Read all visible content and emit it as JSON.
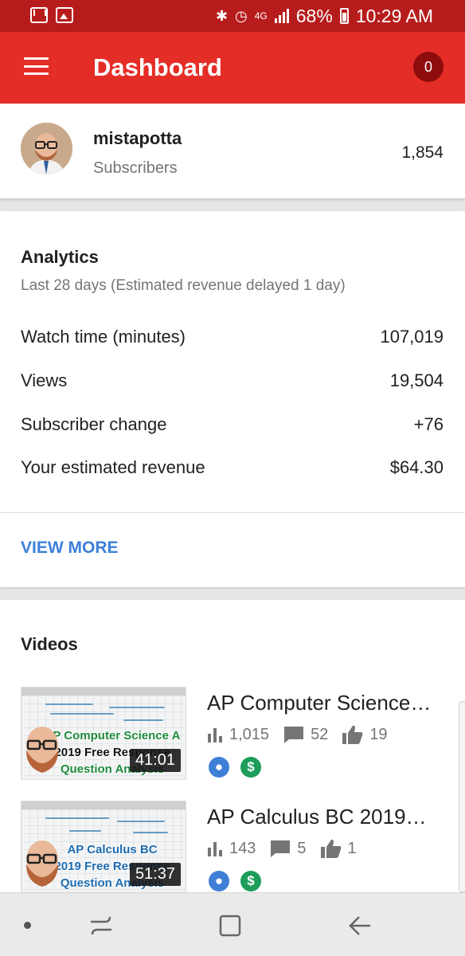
{
  "status_bar": {
    "battery": "68%",
    "time": "10:29 AM",
    "network": "4G"
  },
  "app_bar": {
    "title": "Dashboard",
    "notification_count": "0"
  },
  "channel": {
    "name": "mistapotta",
    "subscribers_label": "Subscribers",
    "subscribers": "1,854"
  },
  "analytics": {
    "title": "Analytics",
    "subtitle": "Last 28 days (Estimated revenue delayed 1 day)",
    "metrics": [
      {
        "label": "Watch time (minutes)",
        "value": "107,019"
      },
      {
        "label": "Views",
        "value": "19,504"
      },
      {
        "label": "Subscriber change",
        "value": "+76"
      },
      {
        "label": "Your estimated revenue",
        "value": "$64.30"
      }
    ],
    "view_more": "VIEW MORE"
  },
  "videos": {
    "title": "Videos",
    "items": [
      {
        "title": "AP Computer Science…",
        "thumb_lines": [
          "AP Computer Science A",
          "2019 Free Response",
          "Question Analysis"
        ],
        "duration": "41:01",
        "views": "1,015",
        "comments": "52",
        "likes": "19"
      },
      {
        "title": "AP Calculus BC 2019…",
        "thumb_lines": [
          "AP Calculus BC",
          "2019 Free Response",
          "Question Analysis"
        ],
        "duration": "51:37",
        "views": "143",
        "comments": "5",
        "likes": "1"
      }
    ]
  },
  "colors": {
    "app_bar": "#e52d27",
    "status_bar": "#b71c1c",
    "link": "#3d7fd8",
    "public_badge": "#3f7fd6",
    "monetized_badge": "#1c9d5a"
  },
  "icons": [
    "mail-icon",
    "image-icon",
    "bluetooth-icon",
    "alarm-icon",
    "wifi-icon",
    "signal-icon",
    "battery-icon",
    "menu-icon",
    "bar-chart-icon",
    "comment-icon",
    "thumbs-up-icon",
    "globe-icon",
    "dollar-icon"
  ]
}
